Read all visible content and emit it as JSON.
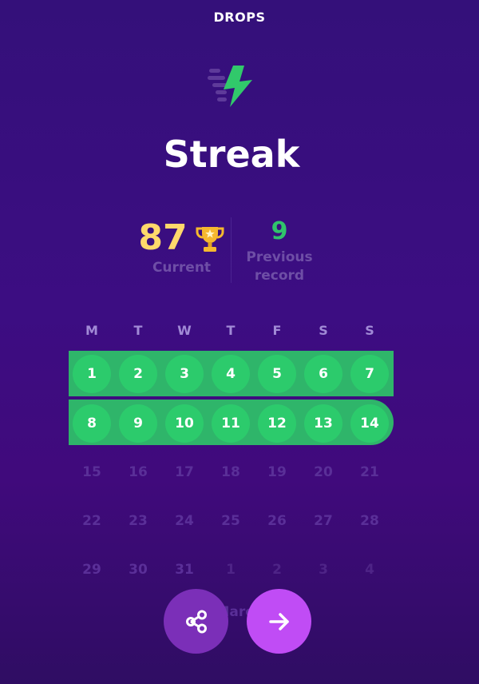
{
  "app": {
    "brand": "DROPS"
  },
  "header": {
    "title": "Streak",
    "logo_icon": "lightning-bolt-icon"
  },
  "stats": {
    "current": {
      "value": "87",
      "label": "Current",
      "icon": "trophy-icon"
    },
    "previous": {
      "value": "9",
      "label_line1": "Previous",
      "label_line2": "record"
    }
  },
  "calendar": {
    "weekdays": [
      "M",
      "T",
      "W",
      "T",
      "F",
      "S",
      "S"
    ],
    "month": "March",
    "weeks": [
      [
        {
          "n": "1",
          "state": "streak"
        },
        {
          "n": "2",
          "state": "streak"
        },
        {
          "n": "3",
          "state": "streak"
        },
        {
          "n": "4",
          "state": "streak"
        },
        {
          "n": "5",
          "state": "streak"
        },
        {
          "n": "6",
          "state": "streak"
        },
        {
          "n": "7",
          "state": "streak"
        }
      ],
      [
        {
          "n": "8",
          "state": "streak"
        },
        {
          "n": "9",
          "state": "streak"
        },
        {
          "n": "10",
          "state": "streak"
        },
        {
          "n": "11",
          "state": "streak"
        },
        {
          "n": "12",
          "state": "streak"
        },
        {
          "n": "13",
          "state": "streak"
        },
        {
          "n": "14",
          "state": "streak"
        }
      ],
      [
        {
          "n": "15",
          "state": "future"
        },
        {
          "n": "16",
          "state": "future"
        },
        {
          "n": "17",
          "state": "future"
        },
        {
          "n": "18",
          "state": "future"
        },
        {
          "n": "19",
          "state": "future"
        },
        {
          "n": "20",
          "state": "future"
        },
        {
          "n": "21",
          "state": "future"
        }
      ],
      [
        {
          "n": "22",
          "state": "future"
        },
        {
          "n": "23",
          "state": "future"
        },
        {
          "n": "24",
          "state": "future"
        },
        {
          "n": "25",
          "state": "future"
        },
        {
          "n": "26",
          "state": "future"
        },
        {
          "n": "27",
          "state": "future"
        },
        {
          "n": "28",
          "state": "future"
        }
      ],
      [
        {
          "n": "29",
          "state": "future"
        },
        {
          "n": "30",
          "state": "future"
        },
        {
          "n": "31",
          "state": "future"
        },
        {
          "n": "1",
          "state": "next-month"
        },
        {
          "n": "2",
          "state": "next-month"
        },
        {
          "n": "3",
          "state": "next-month"
        },
        {
          "n": "4",
          "state": "next-month"
        }
      ]
    ]
  },
  "actions": {
    "share_icon": "share-icon",
    "next_icon": "arrow-right-icon"
  },
  "colors": {
    "streak_green": "#2ccb6c",
    "current_gold": "#ffd86b",
    "record_green": "#30c46b",
    "next_button": "#c04cf5",
    "share_button": "#7b2fb8"
  }
}
